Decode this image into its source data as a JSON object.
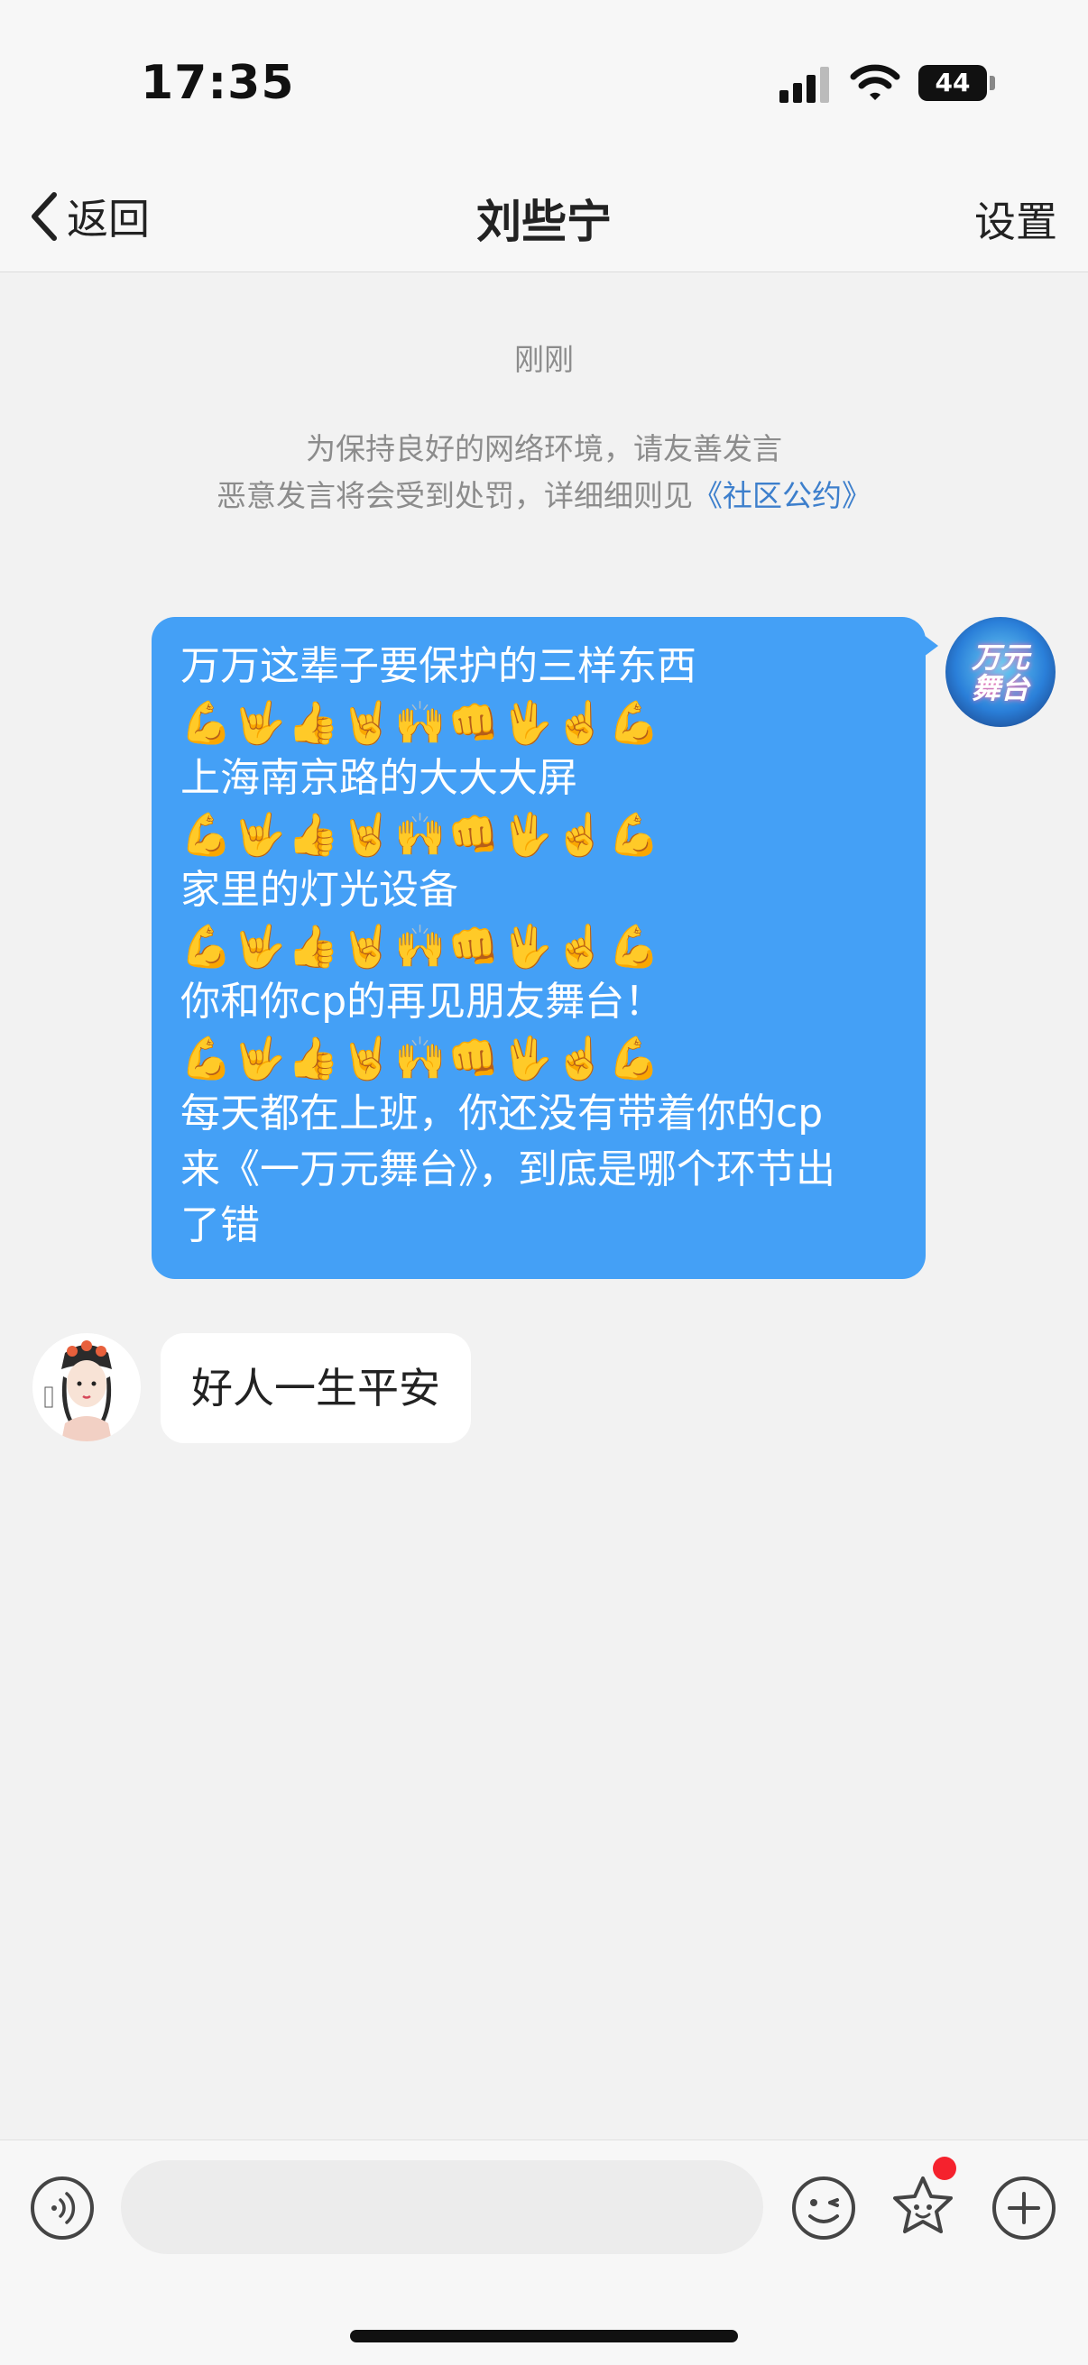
{
  "status_bar": {
    "time": "17:35",
    "battery": "44"
  },
  "header": {
    "back_label": "返回",
    "title": "刘些宁",
    "settings_label": "设置"
  },
  "chat": {
    "timestamp": "刚刚",
    "notice_line1": "为保持良好的网络环境，请友善发言",
    "notice_line2": "恶意发言将会受到处罚，详细细则见",
    "notice_link": "《社区公约》",
    "outgoing": {
      "lines": [
        "万万这辈子要保护的三样东西",
        "💪🤟👍🤘🙌👊🖖☝️💪",
        "上海南京路的大大大屏",
        "💪🤟👍🤘🙌👊🖖☝️💪",
        "家里的灯光设备",
        "💪🤟👍🤘🙌👊🖖☝️💪",
        "你和你cp的再见朋友舞台！",
        "💪🤟👍🤘🙌👊🖖☝️💪",
        "每天都在上班，你还没有带着你的cp",
        "来《一万元舞台》，到底是哪个环节出",
        "了错"
      ],
      "avatar_text_line1": "万元",
      "avatar_text_line2": "舞台"
    },
    "incoming": {
      "text": "好人一生平安"
    }
  },
  "input_bar": {
    "placeholder": ""
  },
  "colors": {
    "bubble_out": "#44a0f6",
    "link": "#3d7fcc",
    "badge": "#f5222d"
  }
}
